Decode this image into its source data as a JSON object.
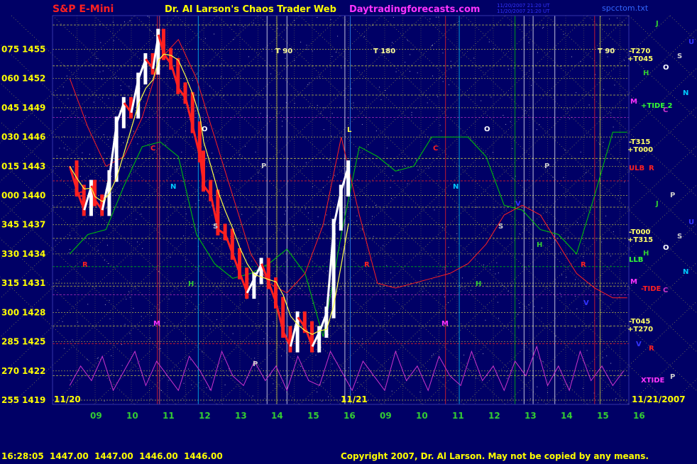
{
  "header": {
    "instrument": "S&P E-Mini",
    "brand": "Dr. Al Larson's Chaos Trader Web",
    "site": "Daytradingforecasts.com",
    "timestamp_line1": "11/20/2007 21:20 UT",
    "timestamp_line2": "11/20/2007 21:20 UT",
    "file": "spcctom.txt"
  },
  "footer": {
    "quote": "16:28:05  1447.00  1447.00  1446.00  1446.00",
    "copyright": "Copyright 2007, Dr. Al Larson. May not be copied by any means."
  },
  "colors": {
    "background": "#000066",
    "price_up": "#ffffff",
    "price_down": "#ff2020",
    "grid_yellow": "#e0e040",
    "axis_labels": "#ffff00",
    "time_labels": "#33cc33",
    "moon_line": "#ff2020",
    "tide_line": "#00cc00",
    "xtide_line": "#cc33cc"
  },
  "chart_data": {
    "type": "line",
    "title": "S&P E-Mini",
    "ylim": [
      1419,
      1457
    ],
    "y_ticks": [
      {
        "code": "075",
        "price": 1455
      },
      {
        "code": "060",
        "price": 1452
      },
      {
        "code": "045",
        "price": 1449
      },
      {
        "code": "030",
        "price": 1446
      },
      {
        "code": "015",
        "price": 1443
      },
      {
        "code": "000",
        "price": 1440
      },
      {
        "code": "345",
        "price": 1437
      },
      {
        "code": "330",
        "price": 1434
      },
      {
        "code": "315",
        "price": 1431
      },
      {
        "code": "300",
        "price": 1428
      },
      {
        "code": "285",
        "price": 1425
      },
      {
        "code": "270",
        "price": 1422
      },
      {
        "code": "255",
        "price": 1419
      }
    ],
    "x_day1": {
      "date": "11/20",
      "hours": [
        "09",
        "10",
        "11",
        "12",
        "13",
        "14",
        "15",
        "16"
      ]
    },
    "x_day2": {
      "date": "11/21",
      "hours": [
        "09",
        "10",
        "11",
        "12",
        "13",
        "14",
        "15",
        "16"
      ],
      "end_date": "11/21/2007"
    },
    "t_labels": [
      "T 90",
      "T 180",
      "T 90"
    ],
    "right_labels": [
      "-T270",
      "+T045",
      "+TIDE 2",
      "-T315",
      "+T000",
      "ULB",
      "-T000",
      "+T315",
      "LLB",
      "-TIDE",
      "-T045",
      "+T270",
      "XTIDE"
    ],
    "planet_glyphs": [
      "J",
      "S",
      "O",
      "U",
      "H",
      "N",
      "M",
      "C",
      "R",
      "P",
      "V"
    ],
    "in_chart_markers": [
      "C",
      "O",
      "N",
      "P",
      "S",
      "H",
      "M",
      "L",
      "R",
      "V"
    ],
    "price_series": {
      "name": "S&P E-Mini",
      "x_hour": [
        8.3,
        8.5,
        8.7,
        8.9,
        9.0,
        9.2,
        9.4,
        9.6,
        9.8,
        10.0,
        10.2,
        10.4,
        10.6,
        10.75,
        10.9,
        11.1,
        11.3,
        11.5,
        11.7,
        11.9,
        12.0,
        12.2,
        12.4,
        12.6,
        12.8,
        13.0,
        13.2,
        13.4,
        13.6,
        13.8,
        14.0,
        14.2,
        14.4,
        14.6,
        14.8,
        15.0,
        15.2,
        15.4,
        15.6,
        15.8,
        16.0
      ],
      "y": [
        1443.0,
        1440.5,
        1438.5,
        1441.0,
        1439.5,
        1438.5,
        1442.0,
        1447.5,
        1449.5,
        1448.5,
        1452.0,
        1454.0,
        1453.0,
        1456.5,
        1454.5,
        1453.5,
        1451.0,
        1450.0,
        1447.0,
        1444.0,
        1441.0,
        1440.0,
        1436.5,
        1436.0,
        1434.0,
        1432.0,
        1430.0,
        1431.5,
        1433.0,
        1431.0,
        1429.0,
        1426.0,
        1424.5,
        1427.5,
        1426.5,
        1424.5,
        1426.0,
        1428.0,
        1437.0,
        1440.5,
        1443.0
      ]
    },
    "moon_series": {
      "name": "",
      "x_hour": [
        8.3,
        8.8,
        9.3,
        9.8,
        10.3,
        10.8,
        11.3,
        11.8,
        12.3,
        12.8,
        13.3,
        13.8,
        14.3,
        14.8,
        15.3,
        15.8,
        16.3,
        16.8,
        17.3,
        17.8,
        18.3,
        18.8,
        19.3,
        19.8,
        20.3,
        20.8,
        21.3,
        21.8,
        22.3,
        22.8,
        23.3,
        23.7
      ],
      "y": [
        1452.0,
        1447.0,
        1443.0,
        1444.0,
        1448.0,
        1454.0,
        1456.0,
        1452.0,
        1446.0,
        1440.0,
        1434.0,
        1431.0,
        1430.0,
        1432.0,
        1437.0,
        1446.0,
        1438.0,
        1431.0,
        1430.5,
        1431.0,
        1431.5,
        1432.0,
        1433.0,
        1435.0,
        1438.0,
        1439.0,
        1438.0,
        1435.0,
        1432.0,
        1430.5,
        1429.5,
        1429.5
      ]
    },
    "tide_series": {
      "name": "",
      "x_hour": [
        8.3,
        8.8,
        9.3,
        9.8,
        10.3,
        10.8,
        11.3,
        11.8,
        12.3,
        12.8,
        13.3,
        13.8,
        14.3,
        14.8,
        15.3,
        15.8,
        16.3,
        16.8,
        17.3,
        17.8,
        18.3,
        18.8,
        19.3,
        19.8,
        20.3,
        20.8,
        21.3,
        21.8,
        22.3,
        22.8,
        23.3,
        23.7
      ],
      "y": [
        1434.0,
        1436.0,
        1436.5,
        1441.0,
        1445.0,
        1445.5,
        1444.0,
        1436.0,
        1433.0,
        1431.5,
        1432.0,
        1433.0,
        1434.5,
        1432.0,
        1425.5,
        1436.0,
        1445.0,
        1444.0,
        1442.5,
        1443.0,
        1446.0,
        1446.0,
        1446.0,
        1444.0,
        1439.0,
        1438.5,
        1436.5,
        1436.0,
        1434.0,
        1440.0,
        1446.5,
        1446.5
      ]
    },
    "xtide_series": {
      "name": "",
      "x_hour": [
        8.3,
        8.6,
        8.9,
        9.2,
        9.5,
        9.8,
        10.1,
        10.4,
        10.7,
        11.0,
        11.3,
        11.6,
        11.9,
        12.2,
        12.5,
        12.8,
        13.1,
        13.4,
        13.7,
        14.0,
        14.3,
        14.6,
        14.9,
        15.2,
        15.5,
        15.8,
        16.1,
        16.4,
        16.7,
        17.0,
        17.3,
        17.6,
        17.9,
        18.2,
        18.5,
        18.8,
        19.1,
        19.4,
        19.7,
        20.0,
        20.3,
        20.6,
        20.9,
        21.2,
        21.5,
        21.8,
        22.1,
        22.4,
        22.7,
        23.0,
        23.3,
        23.6
      ],
      "y": [
        1420.5,
        1422.5,
        1421.0,
        1423.5,
        1420.0,
        1422.0,
        1424.0,
        1420.5,
        1423.0,
        1421.5,
        1420.0,
        1423.5,
        1422.0,
        1420.0,
        1424.0,
        1421.5,
        1420.5,
        1423.0,
        1421.0,
        1422.5,
        1420.0,
        1423.5,
        1421.0,
        1420.5,
        1424.0,
        1422.0,
        1420.0,
        1423.0,
        1421.5,
        1420.0,
        1424.0,
        1421.0,
        1422.5,
        1420.0,
        1423.5,
        1421.5,
        1420.5,
        1424.0,
        1421.0,
        1422.5,
        1420.0,
        1423.0,
        1421.5,
        1424.5,
        1420.5,
        1422.5,
        1420.0,
        1424.0,
        1421.0,
        1422.5,
        1420.5,
        1422.0
      ]
    }
  }
}
